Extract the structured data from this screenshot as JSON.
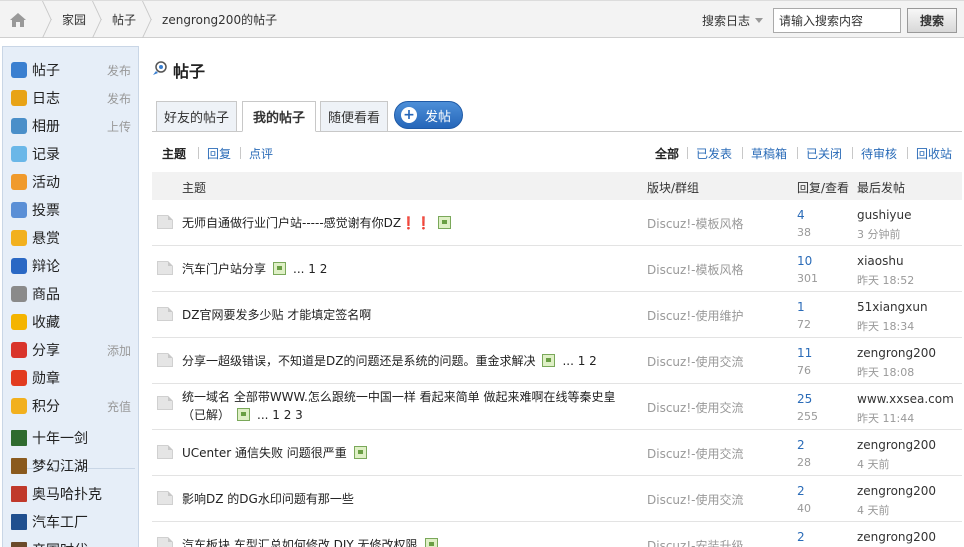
{
  "breadcrumb": [
    "家园",
    "帖子",
    "zengrong200的帖子"
  ],
  "search": {
    "type_label": "搜索日志",
    "placeholder": "请输入搜索内容",
    "button_label": "搜索"
  },
  "sidebar": {
    "items": [
      {
        "label": "帖子",
        "action": "发布",
        "icon": "post-icon",
        "color": "#3a7fd0"
      },
      {
        "label": "日志",
        "action": "发布",
        "icon": "blog-icon",
        "color": "#e8a317"
      },
      {
        "label": "相册",
        "action": "上传",
        "icon": "album-icon",
        "color": "#4a8fc9"
      },
      {
        "label": "记录",
        "action": "",
        "icon": "record-icon",
        "color": "#6ab7e8"
      },
      {
        "label": "活动",
        "action": "",
        "icon": "activity-icon",
        "color": "#f09a2c"
      },
      {
        "label": "投票",
        "action": "",
        "icon": "vote-icon",
        "color": "#5a8fd6"
      },
      {
        "label": "悬赏",
        "action": "",
        "icon": "reward-icon",
        "color": "#f2b01e"
      },
      {
        "label": "辩论",
        "action": "",
        "icon": "debate-icon",
        "color": "#2a68c4"
      },
      {
        "label": "商品",
        "action": "",
        "icon": "goods-icon",
        "color": "#8a8a8a"
      },
      {
        "label": "收藏",
        "action": "",
        "icon": "favorite-icon",
        "color": "#f4b400"
      },
      {
        "label": "分享",
        "action": "添加",
        "icon": "share-icon",
        "color": "#d9342b"
      },
      {
        "label": "勋章",
        "action": "",
        "icon": "medal-icon",
        "color": "#e23b1f"
      },
      {
        "label": "积分",
        "action": "充值",
        "icon": "points-icon",
        "color": "#f2b01e"
      }
    ],
    "apps": [
      {
        "label": "十年一剑",
        "icon": "game-icon-1",
        "color": "#2f6b2f"
      },
      {
        "label": "梦幻江湖",
        "icon": "game-icon-2",
        "color": "#8a5a1e"
      },
      {
        "label": "奥马哈扑克",
        "icon": "game-icon-3",
        "color": "#c0392b"
      },
      {
        "label": "汽车工厂",
        "icon": "game-icon-4",
        "color": "#1f4f8f"
      },
      {
        "label": "帝国时代",
        "icon": "game-icon-5",
        "color": "#6b4a2a"
      }
    ]
  },
  "main": {
    "title": "帖子",
    "tabs": [
      "好友的帖子",
      "我的帖子",
      "随便看看"
    ],
    "post_button": "发帖",
    "left_filters": [
      "主题",
      "回复",
      "点评"
    ],
    "right_filters": [
      "全部",
      "已发表",
      "草稿箱",
      "已关闭",
      "待审核",
      "回收站"
    ],
    "columns": [
      "主题",
      "版块/群组",
      "回复/查看",
      "最后发帖"
    ]
  },
  "threads": [
    {
      "subject": "无师自通做行业门户站-----感觉谢有你DZ❗❗",
      "attach": true,
      "pages": "",
      "forum": "Discuz!-模板风格",
      "replies": "4",
      "views": "38",
      "last_user": "gushiyue",
      "last_time": "3 分钟前"
    },
    {
      "subject": "汽车门户站分享",
      "attach": true,
      "pages": "... 1 2",
      "forum": "Discuz!-模板风格",
      "replies": "10",
      "views": "301",
      "last_user": "xiaoshu",
      "last_time": "昨天 18:52"
    },
    {
      "subject": "DZ官网要发多少贴 才能填定签名啊",
      "attach": false,
      "pages": "",
      "forum": "Discuz!-使用维护",
      "replies": "1",
      "views": "72",
      "last_user": "51xiangxun",
      "last_time": "昨天 18:34"
    },
    {
      "subject": "分享一超级错误，不知道是DZ的问题还是系统的问题。重金求解决",
      "attach": true,
      "pages": "... 1 2",
      "forum": "Discuz!-使用交流",
      "replies": "11",
      "views": "76",
      "last_user": "zengrong200",
      "last_time": "昨天 18:08"
    },
    {
      "subject": "统一域名 全部带WWW.怎么跟统一中国一样 看起来简单 做起来难啊在线等秦史皇",
      "subject2": "（已解）",
      "attach": true,
      "pages": "... 1 2 3",
      "forum": "Discuz!-使用交流",
      "replies": "25",
      "views": "255",
      "last_user": "www.xxsea.com",
      "last_time": "昨天 11:44"
    },
    {
      "subject": "UCenter 通信失败 问题很严重",
      "attach": true,
      "pages": "",
      "forum": "Discuz!-使用交流",
      "replies": "2",
      "views": "28",
      "last_user": "zengrong200",
      "last_time": "4 天前"
    },
    {
      "subject": "影响DZ 的DG水印问题有那一些",
      "attach": false,
      "pages": "",
      "forum": "Discuz!-使用交流",
      "replies": "2",
      "views": "40",
      "last_user": "zengrong200",
      "last_time": "4 天前"
    },
    {
      "subject": "汽车板块 车型汇总如何修改 DIY 无修改权限",
      "attach": true,
      "pages": "",
      "forum": "Discuz!-安装升级",
      "replies": "2",
      "views": "",
      "last_user": "zengrong200",
      "last_time": ""
    }
  ]
}
